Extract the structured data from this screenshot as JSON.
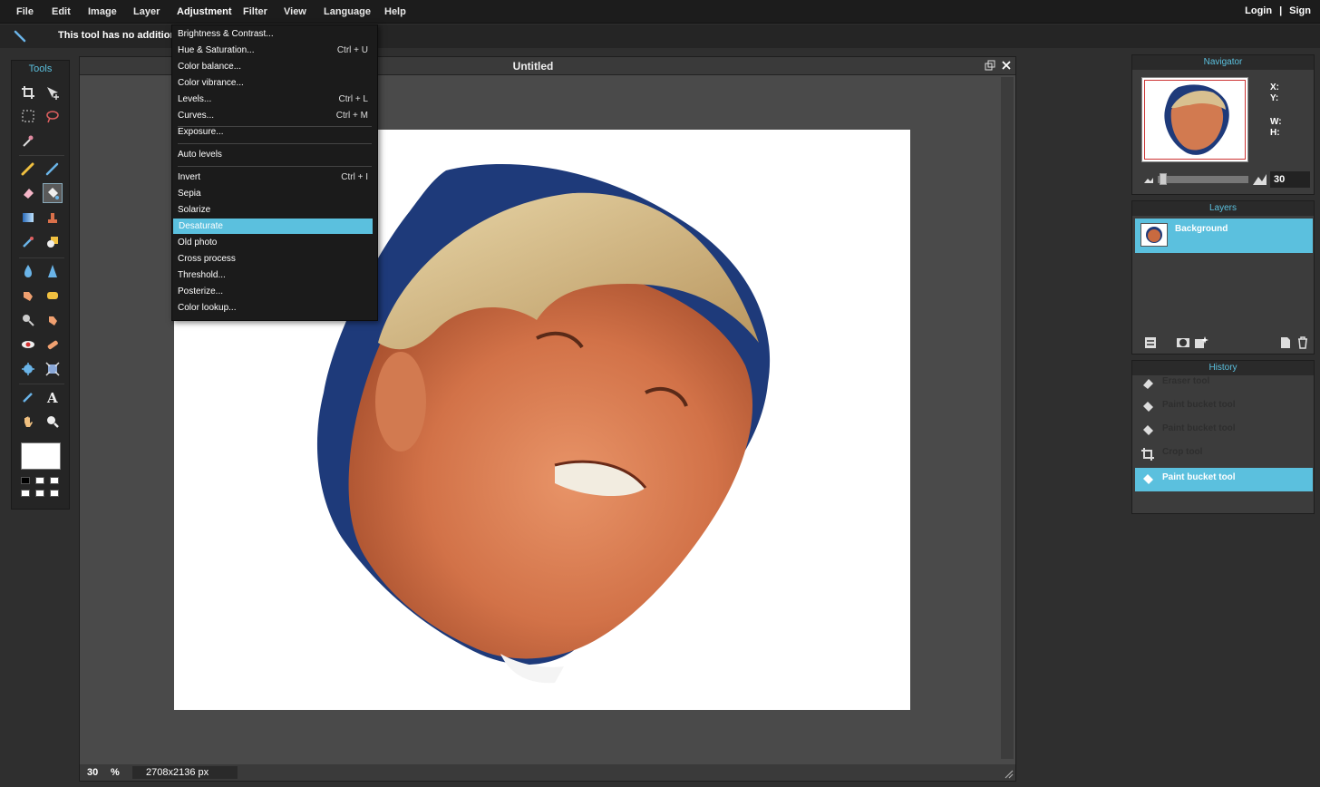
{
  "menubar": {
    "items": [
      "File",
      "Edit",
      "Image",
      "Layer",
      "Adjustment",
      "Filter",
      "View",
      "Language",
      "Help"
    ],
    "login": "Login",
    "sign": "Sign",
    "divider": "|"
  },
  "optionbar": {
    "message": "This tool has no additional"
  },
  "tools": {
    "title": "Tools"
  },
  "document": {
    "title": "Untitled",
    "zoom": "30",
    "zoom_unit": "%",
    "size": "2708x2136 px"
  },
  "adjustment_menu": {
    "items": [
      {
        "label": "Brightness & Contrast...",
        "shortcut": ""
      },
      {
        "label": "Hue & Saturation...",
        "shortcut": "Ctrl + U"
      },
      {
        "label": "Color balance...",
        "shortcut": ""
      },
      {
        "label": "Color vibrance...",
        "shortcut": ""
      },
      {
        "label": "Levels...",
        "shortcut": "Ctrl + L"
      },
      {
        "label": "Curves...",
        "shortcut": "Ctrl + M"
      },
      {
        "label": "Exposure...",
        "shortcut": ""
      },
      {
        "label": "Auto levels",
        "shortcut": ""
      },
      {
        "label": "Invert",
        "shortcut": "Ctrl + I"
      },
      {
        "label": "Sepia",
        "shortcut": ""
      },
      {
        "label": "Solarize",
        "shortcut": ""
      },
      {
        "label": "Desaturate",
        "shortcut": ""
      },
      {
        "label": "Old photo",
        "shortcut": ""
      },
      {
        "label": "Cross process",
        "shortcut": ""
      },
      {
        "label": "Threshold...",
        "shortcut": ""
      },
      {
        "label": "Posterize...",
        "shortcut": ""
      },
      {
        "label": "Color lookup...",
        "shortcut": ""
      }
    ],
    "highlighted": "Desaturate"
  },
  "navigator": {
    "title": "Navigator",
    "x_label": "X:",
    "y_label": "Y:",
    "w_label": "W:",
    "h_label": "H:",
    "zoom_value": "30"
  },
  "layers": {
    "title": "Layers",
    "items": [
      {
        "name": "Background"
      }
    ]
  },
  "history": {
    "title": "History",
    "items": [
      {
        "label": "Eraser tool"
      },
      {
        "label": "Paint bucket tool"
      },
      {
        "label": "Paint bucket tool"
      },
      {
        "label": "Crop tool"
      },
      {
        "label": "Paint bucket tool"
      }
    ]
  },
  "colors": {
    "accent": "#5bc0de",
    "menubar": "#1c1c1c",
    "panel": "#3c3c3c",
    "canvas_bg": "#4a4a4a"
  }
}
